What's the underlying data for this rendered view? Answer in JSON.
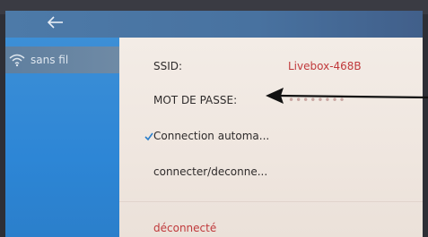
{
  "sidebar": {
    "items": [
      {
        "label": "sans fil",
        "icon": "wifi-icon"
      }
    ]
  },
  "wifi": {
    "ssid_label": "SSID:",
    "ssid_value": "Livebox-468B",
    "password_label": "MOT DE PASSE:",
    "password_value": "••••••••",
    "auto_connect_label": "Connection automa...",
    "auto_connect_checked": true,
    "connect_toggle_label": "connecter/deconne...",
    "status": "déconnecté"
  },
  "colors": {
    "titlebar": "#4d7aa8",
    "sidebar": "#2d86d6",
    "content_bg": "#f3ece6",
    "accent_red": "#c0393b"
  }
}
